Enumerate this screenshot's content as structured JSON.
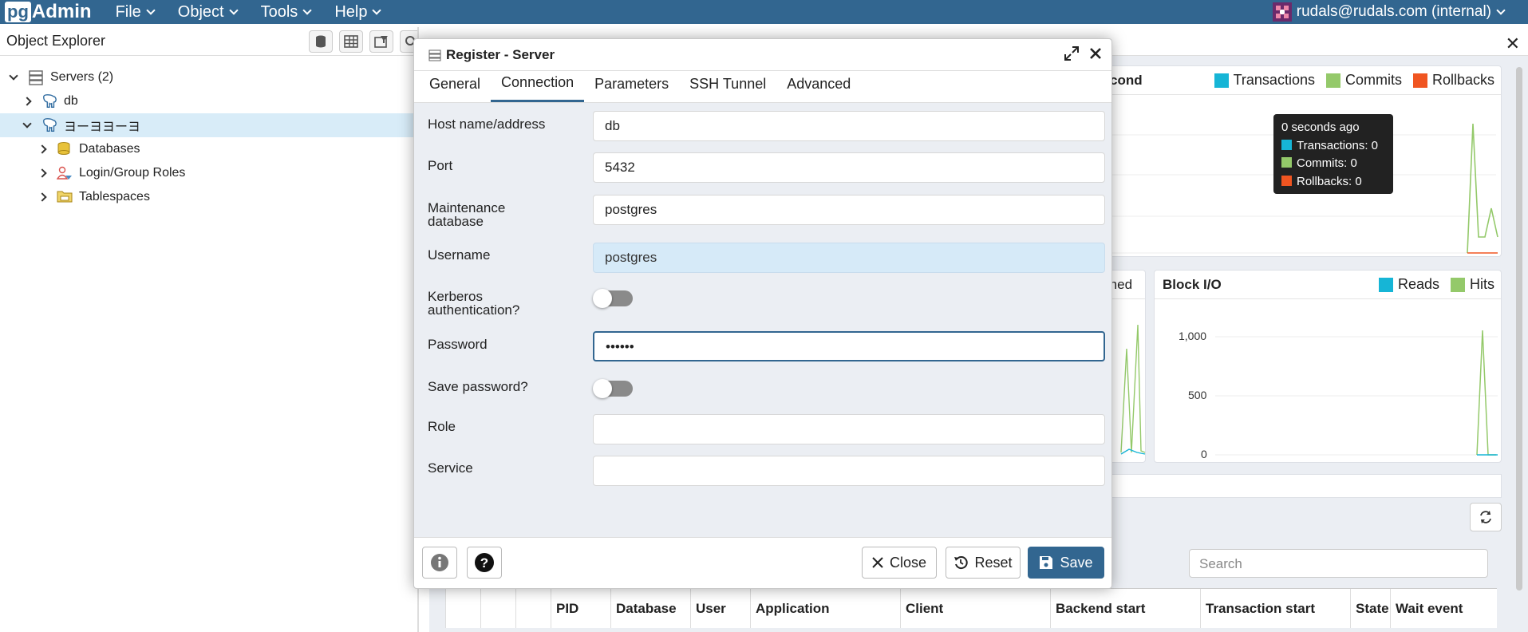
{
  "navbar": {
    "logo_pg": "pg",
    "logo_admin": "Admin",
    "menu": [
      "File",
      "Object",
      "Tools",
      "Help"
    ],
    "user": "rudals@rudals.com (internal)"
  },
  "explorer": {
    "title": "Object Explorer",
    "tree": [
      {
        "label": "Servers (2)",
        "icon": "servers-icon"
      },
      {
        "label": "db",
        "icon": "elephant-icon"
      },
      {
        "label": "ヨーヨヨーヨ",
        "icon": "elephant-icon"
      },
      {
        "label": "Databases",
        "icon": "database-icon"
      },
      {
        "label": "Login/Group Roles",
        "icon": "roles-icon"
      },
      {
        "label": "Tablespaces",
        "icon": "folder-icon"
      }
    ]
  },
  "dashboard": {
    "panel1_title_partial": "cond",
    "legend1": [
      "Transactions",
      "Commits",
      "Rollbacks"
    ],
    "panel2_title_partial": "rned",
    "block_io_title": "Block I/O",
    "legend2": [
      "Reads",
      "Hits"
    ],
    "yticks": [
      "1,000",
      "500",
      "0"
    ],
    "search_placeholder": "Search",
    "tooltip": {
      "time": "0 seconds ago",
      "rows": [
        "Transactions: 0",
        "Commits: 0",
        "Rollbacks: 0"
      ]
    },
    "grid_columns": [
      "",
      "",
      "",
      "PID",
      "Database",
      "User",
      "Application",
      "Client",
      "Backend start",
      "Transaction start",
      "State",
      "Wait event"
    ],
    "colors": {
      "transactions": "#16b5d6",
      "commits": "#94c96a",
      "rollbacks": "#f05521"
    }
  },
  "modal": {
    "title": "Register - Server",
    "tabs": [
      "General",
      "Connection",
      "Parameters",
      "SSH Tunnel",
      "Advanced"
    ],
    "active_tab": "Connection",
    "fields": {
      "host_label": "Host name/address",
      "host_value": "db",
      "port_label": "Port",
      "port_value": "5432",
      "maint_label_1": "Maintenance",
      "maint_label_2": "database",
      "maint_value": "postgres",
      "username_label": "Username",
      "username_value": "postgres",
      "kerberos_label_1": "Kerberos",
      "kerberos_label_2": "authentication?",
      "kerberos_on": false,
      "password_label": "Password",
      "password_value": "••••••",
      "save_password_label": "Save password?",
      "save_password_on": false,
      "role_label": "Role",
      "role_value": "",
      "service_label": "Service",
      "service_value": ""
    },
    "footer": {
      "close": "Close",
      "reset": "Reset",
      "save": "Save"
    }
  }
}
